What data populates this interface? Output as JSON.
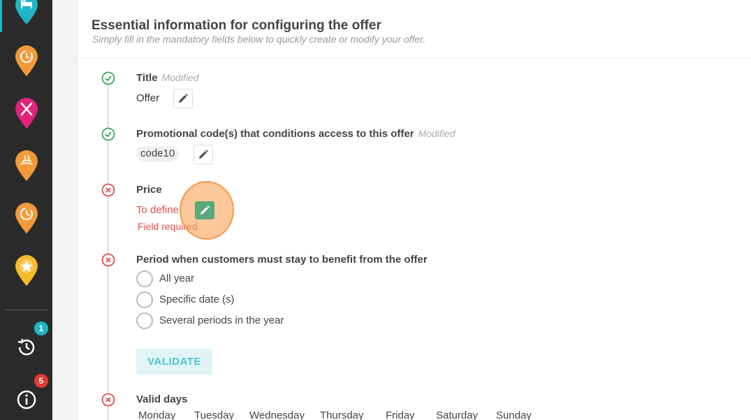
{
  "sidebar": {
    "pins": [
      {
        "icon": "bed-icon",
        "color": "#1fb5c4"
      },
      {
        "icon": "clock-icon",
        "color": "#f29a3a"
      },
      {
        "icon": "restaurant-icon",
        "color": "#e0227a"
      },
      {
        "icon": "spa-icon",
        "color": "#f29a3a"
      },
      {
        "icon": "clock-icon",
        "color": "#f29a3a"
      },
      {
        "icon": "star-icon",
        "color": "#f7b92a"
      }
    ],
    "history_badge": "1",
    "info_badge": "5"
  },
  "card": {
    "title": "Essential information for configuring the offer",
    "subtitle": "Simply fill in the mandatory fields below to quickly create or modify your offer."
  },
  "fields": {
    "title": {
      "label": "Title",
      "modified": "Modified",
      "value": "Offer",
      "status": "valid"
    },
    "promo": {
      "label": "Promotional code(s) that conditions access to this offer",
      "modified": "Modified",
      "value": "code10",
      "status": "valid"
    },
    "price": {
      "label": "Price",
      "value": "To define",
      "error": "Field required",
      "status": "invalid"
    },
    "period": {
      "label": "Period when customers must stay to benefit from the offer",
      "status": "invalid",
      "options": [
        "All year",
        "Specific date (s)",
        "Several periods in the year"
      ]
    },
    "validate_label": "VALIDATE",
    "valid_days": {
      "label": "Valid days",
      "status": "invalid",
      "days": [
        "Monday",
        "Tuesday",
        "Wednesday",
        "Thursday",
        "Friday",
        "Saturday",
        "Sunday"
      ]
    }
  },
  "colors": {
    "valid": "#3aa655",
    "invalid": "#e24b4b",
    "accent": "#1fb5c4"
  }
}
